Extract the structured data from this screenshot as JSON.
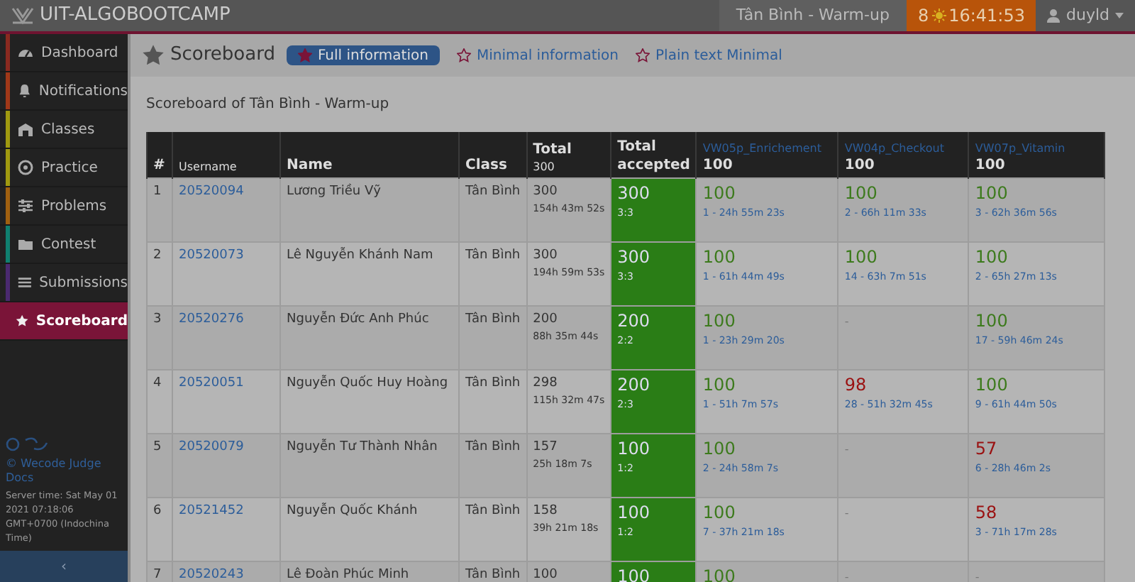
{
  "app_title": "UIT-ALGOBOOTCAMP",
  "topbar": {
    "contest": "Tân Bình - Warm-up",
    "days": "8",
    "clock": "16:41:53",
    "user": "duyld"
  },
  "sidebar": {
    "items": [
      {
        "label": "Dashboard",
        "kind": "dashboard",
        "color": "#8a2a20",
        "selected": false
      },
      {
        "label": "Notifications",
        "kind": "bell",
        "color": "#a03818",
        "selected": false
      },
      {
        "label": "Classes",
        "kind": "classes",
        "color": "#a09a10",
        "selected": false
      },
      {
        "label": "Practice",
        "kind": "practice",
        "color": "#a09a10",
        "selected": false
      },
      {
        "label": "Problems",
        "kind": "sliders",
        "color": "#a06010",
        "selected": false
      },
      {
        "label": "Contest",
        "kind": "folder",
        "color": "#108070",
        "selected": false
      },
      {
        "label": "Submissions",
        "kind": "list",
        "color": "#4a2a70",
        "selected": false
      },
      {
        "label": "Scoreboard",
        "kind": "star",
        "selected": true
      }
    ],
    "footer_link": "© Wecode Judge Docs",
    "server_time": "Server time: Sat May 01 2021 07:18:06 GMT+0700 (Indochina Time)",
    "collapse": "‹"
  },
  "page": {
    "title": "Scoreboard",
    "views": [
      {
        "label": "Full information",
        "selected": true
      },
      {
        "label": "Minimal information",
        "selected": false
      },
      {
        "label": "Plain text Minimal",
        "selected": false
      }
    ],
    "subtitle": "Scoreboard of Tân Bình - Warm-up"
  },
  "table": {
    "columns": [
      {
        "label": "#"
      },
      {
        "label": "Username"
      },
      {
        "label": "Name"
      },
      {
        "label": "Class"
      },
      {
        "label": "Total",
        "sub": "300"
      },
      {
        "label": "Total accepted"
      },
      {
        "label": "VW05p_Enrichement",
        "sub": "100",
        "kind": "problem"
      },
      {
        "label": "VW04p_Checkout",
        "sub": "100",
        "kind": "problem"
      },
      {
        "label": "VW07p_Vitamin",
        "sub": "100",
        "kind": "problem"
      }
    ],
    "rows": [
      {
        "rank": "1",
        "username": "20520094",
        "name": "Lương Triều Vỹ",
        "class": "Tân Bình",
        "total": "300",
        "time": "154h 43m 52s",
        "accepted": "300",
        "accepted_ratio": "3:3",
        "problems": [
          {
            "kind": "full",
            "score": "100",
            "detail": "1 - 24h 55m 23s"
          },
          {
            "kind": "full",
            "score": "100",
            "detail": "2 - 66h 11m 33s"
          },
          {
            "kind": "full",
            "score": "100",
            "detail": "3 - 62h 36m 56s"
          }
        ]
      },
      {
        "rank": "2",
        "username": "20520073",
        "name": "Lê Nguyễn Khánh Nam",
        "class": "Tân Bình",
        "total": "300",
        "time": "194h 59m 53s",
        "accepted": "300",
        "accepted_ratio": "3:3",
        "problems": [
          {
            "kind": "full",
            "score": "100",
            "detail": "1 - 61h 44m 49s"
          },
          {
            "kind": "full",
            "score": "100",
            "detail": "14 - 63h 7m 51s"
          },
          {
            "kind": "full",
            "score": "100",
            "detail": "2 - 65h 27m 13s"
          }
        ]
      },
      {
        "rank": "3",
        "username": "20520276",
        "name": "Nguyễn Đức Anh Phúc",
        "class": "Tân Bình",
        "total": "200",
        "time": "88h 35m 44s",
        "accepted": "200",
        "accepted_ratio": "2:2",
        "problems": [
          {
            "kind": "full",
            "score": "100",
            "detail": "1 - 23h 29m 20s"
          },
          {
            "kind": "none",
            "score": "-"
          },
          {
            "kind": "full",
            "score": "100",
            "detail": "17 - 59h 46m 24s"
          }
        ]
      },
      {
        "rank": "4",
        "username": "20520051",
        "name": "Nguyễn Quốc Huy Hoàng",
        "class": "Tân Bình",
        "total": "298",
        "time": "115h 32m 47s",
        "accepted": "200",
        "accepted_ratio": "2:3",
        "problems": [
          {
            "kind": "full",
            "score": "100",
            "detail": "1 - 51h 7m 57s"
          },
          {
            "kind": "partial",
            "score": "98",
            "detail": "28 - 51h 32m 45s"
          },
          {
            "kind": "full",
            "score": "100",
            "detail": "9 - 61h 44m 50s"
          }
        ]
      },
      {
        "rank": "5",
        "username": "20520079",
        "name": "Nguyễn Tư Thành Nhân",
        "class": "Tân Bình",
        "total": "157",
        "time": "25h 18m 7s",
        "accepted": "100",
        "accepted_ratio": "1:2",
        "problems": [
          {
            "kind": "full",
            "score": "100",
            "detail": "2 - 24h 58m 7s"
          },
          {
            "kind": "none",
            "score": "-"
          },
          {
            "kind": "partial",
            "score": "57",
            "detail": "6 - 28h 46m 2s"
          }
        ]
      },
      {
        "rank": "6",
        "username": "20521452",
        "name": "Nguyễn Quốc Khánh",
        "class": "Tân Bình",
        "total": "158",
        "time": "39h 21m 18s",
        "accepted": "100",
        "accepted_ratio": "1:2",
        "problems": [
          {
            "kind": "full",
            "score": "100",
            "detail": "7 - 37h 21m 18s"
          },
          {
            "kind": "none",
            "score": "-"
          },
          {
            "kind": "partial",
            "score": "58",
            "detail": "3 - 71h 17m 28s"
          }
        ]
      },
      {
        "rank": "7",
        "username": "20520243",
        "name": "Lê Đoàn Phúc Minh",
        "class": "Tân Bình",
        "total": "100",
        "accepted": "100",
        "problems": [
          {
            "kind": "full",
            "score": "100"
          },
          {
            "kind": "none",
            "score": "-"
          },
          {
            "kind": "none",
            "score": "-"
          }
        ]
      }
    ]
  }
}
